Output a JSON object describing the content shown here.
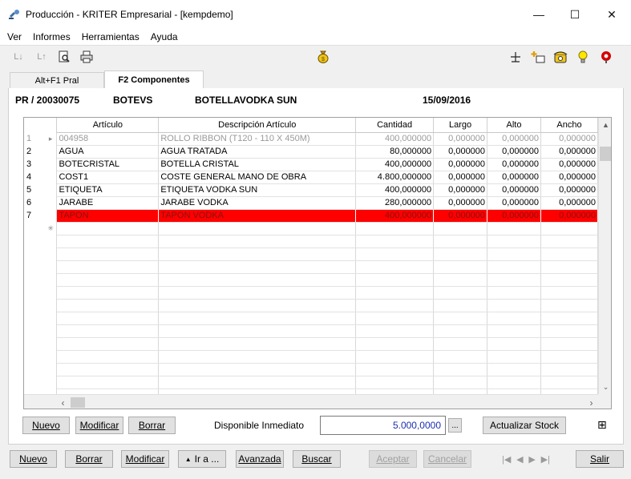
{
  "window": {
    "title": "Producción - KRITER Empresarial  - [kempdemo]",
    "min_glyph": "—",
    "max_glyph": "☐",
    "close_glyph": "✕"
  },
  "menu": [
    "Ver",
    "Informes",
    "Herramientas",
    "Ayuda"
  ],
  "toolbar": {
    "left_icons": [
      "sort-desc-icon",
      "sort-asc-icon",
      "print-preview-icon",
      "printer-icon"
    ],
    "center_icon": "money-bag-icon",
    "right_icons": [
      "split-grid-icon",
      "add-window-icon",
      "phone-icon",
      "lightbulb-icon",
      "lifebuoy-icon"
    ],
    "sort_desc_glyph": "L↓",
    "sort_asc_glyph": "L↑"
  },
  "tabs": [
    {
      "label": "Alt+F1 Pral",
      "active": false
    },
    {
      "label": "F2 Componentes",
      "active": true
    }
  ],
  "header": {
    "code": "PR / 20030075",
    "ref": "BOTEVS",
    "name": "BOTELLAVODKA SUN",
    "date": "15/09/2016"
  },
  "grid": {
    "columns": [
      "Artículo",
      "Descripción Artículo",
      "Cantidad",
      "Largo",
      "Alto",
      "Ancho"
    ],
    "rows": [
      {
        "n": "1",
        "articulo": "004958",
        "descripcion": "ROLLO RIBBON (T120 - 110 X 450M)",
        "cantidad": "400,000000",
        "largo": "0,000000",
        "alto": "0,000000",
        "ancho": "0,000000"
      },
      {
        "n": "2",
        "articulo": "AGUA",
        "descripcion": "AGUA TRATADA",
        "cantidad": "80,000000",
        "largo": "0,000000",
        "alto": "0,000000",
        "ancho": "0,000000"
      },
      {
        "n": "3",
        "articulo": "BOTECRISTAL",
        "descripcion": "BOTELLA CRISTAL",
        "cantidad": "400,000000",
        "largo": "0,000000",
        "alto": "0,000000",
        "ancho": "0,000000"
      },
      {
        "n": "4",
        "articulo": "COST1",
        "descripcion": "COSTE GENERAL MANO DE OBRA",
        "cantidad": "4.800,000000",
        "largo": "0,000000",
        "alto": "0,000000",
        "ancho": "0,000000"
      },
      {
        "n": "5",
        "articulo": "ETIQUETA",
        "descripcion": "ETIQUETA VODKA SUN",
        "cantidad": "400,000000",
        "largo": "0,000000",
        "alto": "0,000000",
        "ancho": "0,000000"
      },
      {
        "n": "6",
        "articulo": "JARABE",
        "descripcion": "JARABE VODKA",
        "cantidad": "280,000000",
        "largo": "0,000000",
        "alto": "0,000000",
        "ancho": "0,000000"
      },
      {
        "n": "7",
        "articulo": "TAPON",
        "descripcion": "TAPON VODKA",
        "cantidad": "400,000000",
        "largo": "0,000000",
        "alto": "0,000000",
        "ancho": "0,000000"
      }
    ],
    "current_row_marker": "▸",
    "new_row_marker": "✳",
    "highlight_color": "#ff0000"
  },
  "panel_buttons": {
    "nuevo": "Nuevo",
    "modificar": "Modificar",
    "borrar": "Borrar",
    "disponible_label": "Disponible Inmediato",
    "disponible_value": "5.000,0000",
    "ellipsis": "...",
    "actualizar": "Actualizar Stock",
    "split_glyph": "⊞"
  },
  "bottom_buttons": {
    "nuevo": "Nuevo",
    "borrar": "Borrar",
    "modificar": "Modificar",
    "ir_a": "Ir a ...",
    "ir_a_glyph": "▲",
    "avanzada": "Avanzada",
    "buscar": "Buscar",
    "aceptar": "Aceptar",
    "cancelar": "Cancelar",
    "salir": "Salir"
  },
  "record_nav": [
    "first-record-icon",
    "prev-record-icon",
    "next-record-icon",
    "last-record-icon"
  ]
}
